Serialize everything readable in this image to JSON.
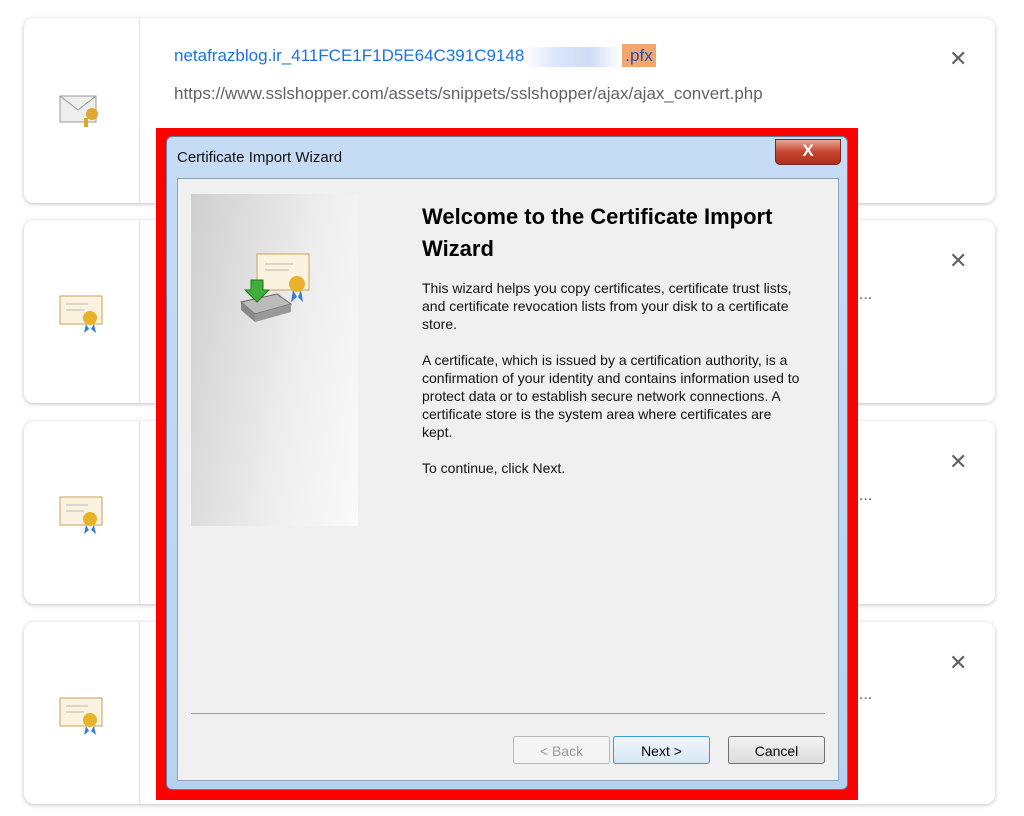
{
  "downloads": [
    {
      "filename_prefix": "netafrazblog.ir_411FCE1F1D5E64C391C9148",
      "filename_ext": ".pfx",
      "url": "https://www.sslshopper.com/assets/snippets/sslshopper/ajax/ajax_convert.php",
      "icon": "pfx-key-envelope-icon",
      "close": "✕"
    },
    {
      "trailing": "d...",
      "icon": "certificate-icon",
      "close": "✕"
    },
    {
      "trailing": "d...",
      "icon": "certificate-icon",
      "close": "✕"
    },
    {
      "trailing": "d...",
      "icon": "certificate-icon",
      "close": "✕"
    }
  ],
  "dialog": {
    "title": "Certificate Import Wizard",
    "close": "X",
    "heading": "Welcome to the Certificate Import Wizard",
    "para1": "This wizard helps you copy certificates, certificate trust lists, and certificate revocation lists from your disk to a certificate store.",
    "para2": "A certificate, which is issued by a certification authority, is a confirmation of your identity and contains information used to protect data or to establish secure network connections. A certificate store is the system area where certificates are kept.",
    "para3": "To continue, click Next.",
    "back": "< Back",
    "next": "Next >",
    "cancel": "Cancel",
    "highlight_color": "#ff0000"
  }
}
